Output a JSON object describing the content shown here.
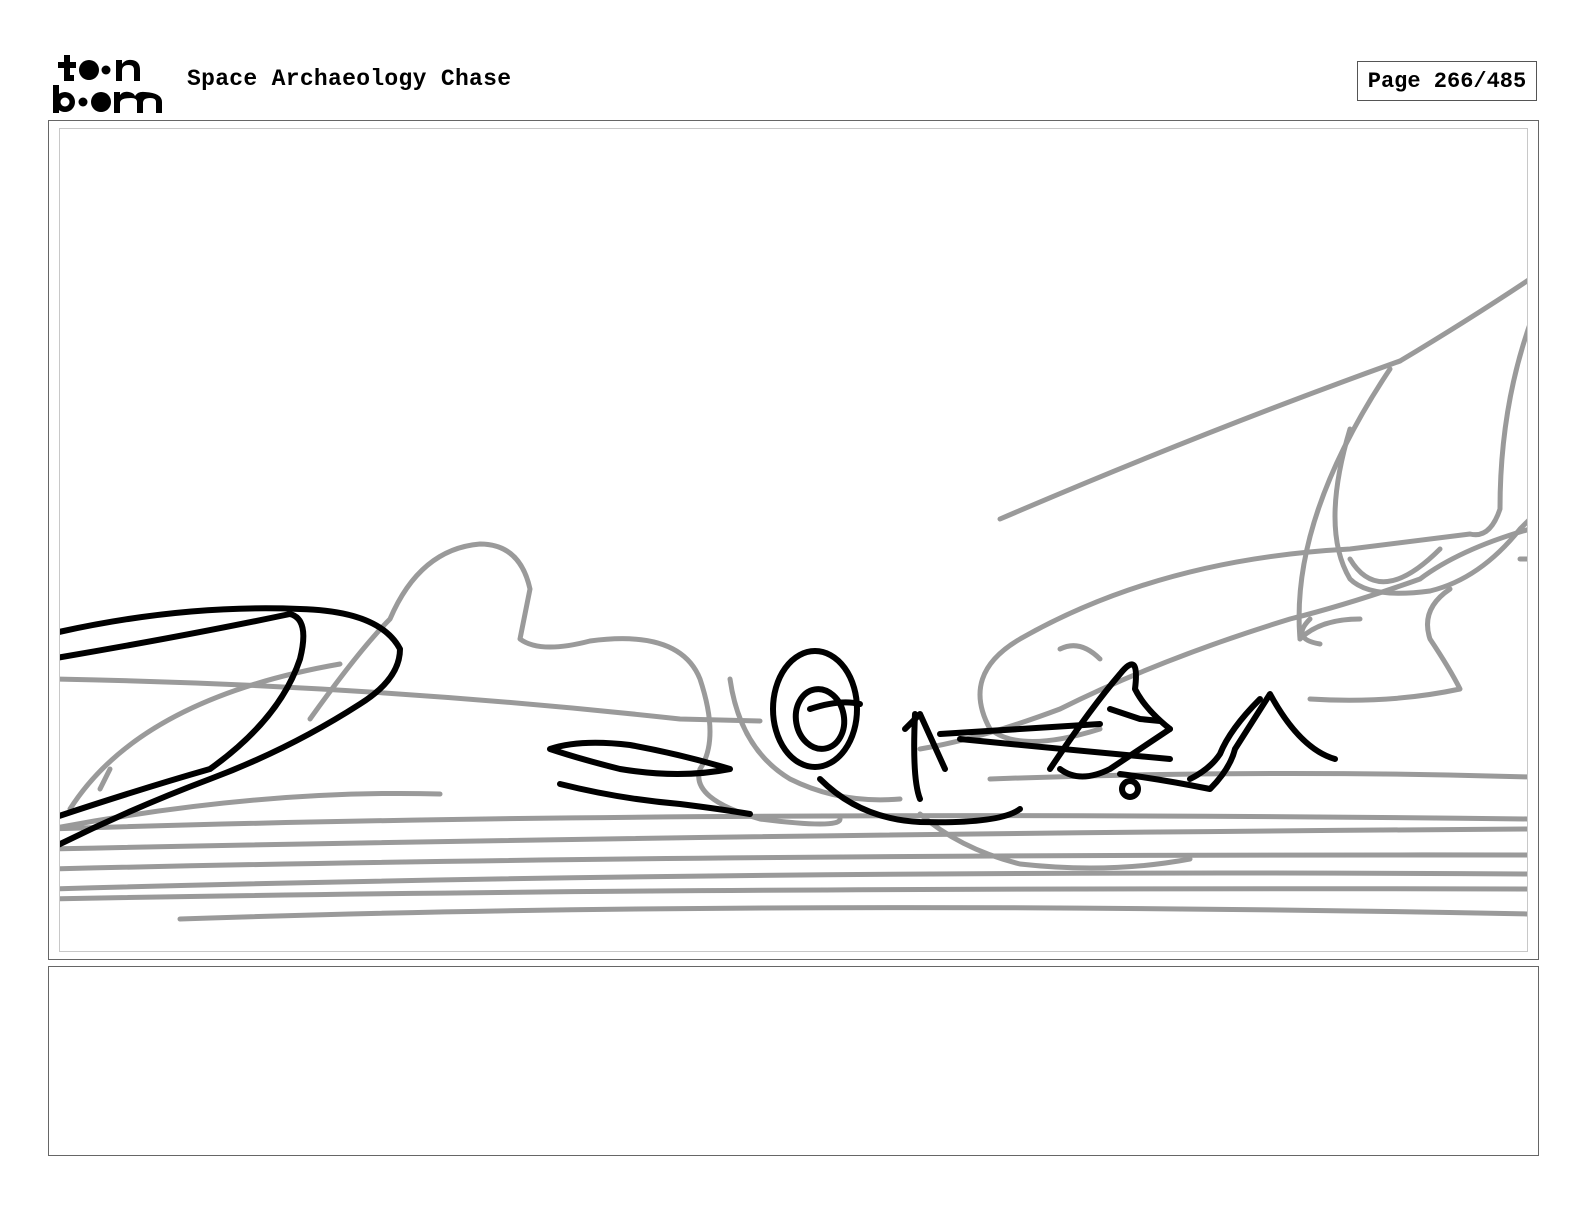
{
  "header": {
    "logo_text": "toon boom",
    "project_title": "Space Archaeology Chase",
    "page_label": "Page 266/485"
  },
  "panel": {
    "image": "storyboard-sketch",
    "colors": {
      "rough_lines": "#999999",
      "ink_lines": "#000000",
      "frame": "#666666"
    }
  },
  "notes": {
    "text": ""
  }
}
